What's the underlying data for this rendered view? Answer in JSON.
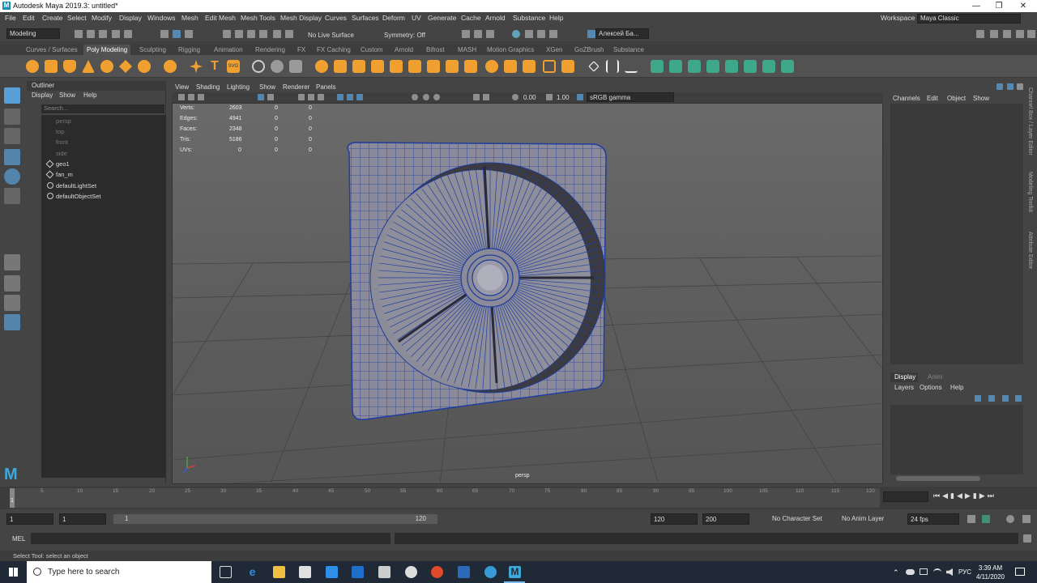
{
  "window": {
    "title": "Autodesk Maya 2019.3: untitled*",
    "logo": "M"
  },
  "menu": [
    "File",
    "Edit",
    "Create",
    "Select",
    "Modify",
    "Display",
    "Windows",
    "Mesh",
    "Edit Mesh",
    "Mesh Tools",
    "Mesh Display",
    "Curves",
    "Surfaces",
    "Deform",
    "UV",
    "Generate",
    "Cache",
    "Arnold",
    "Substance",
    "Help"
  ],
  "workspace": {
    "label": "Workspace :",
    "value": "Maya Classic"
  },
  "status": {
    "mode": "Modeling",
    "live_surface": "No Live Surface",
    "symmetry": "Symmetry: Off",
    "user": "Алексей Ба..."
  },
  "shelf_tabs": [
    "Curves / Surfaces",
    "Poly Modeling",
    "Sculpting",
    "Rigging",
    "Animation",
    "Rendering",
    "FX",
    "FX Caching",
    "Custom",
    "Arnold",
    "Bifrost",
    "MASH",
    "Motion Graphics",
    "XGen",
    "GoZBrush",
    "Substance"
  ],
  "shelf_active": "Poly Modeling",
  "outliner": {
    "title": "Outliner",
    "menu": [
      "Display",
      "Show",
      "Help"
    ],
    "search_placeholder": "Search...",
    "items": [
      "persp",
      "top",
      "front",
      "side",
      "geo1",
      "fan_m",
      "defaultLightSet",
      "defaultObjectSet"
    ]
  },
  "viewport": {
    "menu": [
      "View",
      "Shading",
      "Lighting",
      "Show",
      "Renderer",
      "Panels"
    ],
    "exposure": "0.00",
    "gamma": "1.00",
    "colorspace": "sRGB gamma",
    "camera": "persp",
    "hud": {
      "labels": [
        "Verts:",
        "Edges:",
        "Faces:",
        "Tris:",
        "UVs:"
      ],
      "col1": [
        "2603",
        "4941",
        "2348",
        "5186",
        "0"
      ],
      "col2": [
        "0",
        "0",
        "0",
        "0",
        "0"
      ],
      "col3": [
        "0",
        "0",
        "0",
        "0",
        "0"
      ]
    }
  },
  "channel_box": {
    "menu": [
      "Channels",
      "Edit",
      "Object",
      "Show"
    ]
  },
  "layer_editor": {
    "tabs": [
      "Display",
      "Anim"
    ],
    "menu": [
      "Layers",
      "Options",
      "Help"
    ]
  },
  "side_tabs": [
    "Channel Box / Layer Editor",
    "Modeling Toolkit",
    "Attribute Editor"
  ],
  "timeline": {
    "ticks": [
      "1",
      "5",
      "10",
      "15",
      "20",
      "25",
      "30",
      "35",
      "40",
      "45",
      "50",
      "55",
      "60",
      "65",
      "70",
      "75",
      "80",
      "85",
      "90",
      "95",
      "100",
      "105",
      "110",
      "115",
      "120"
    ],
    "current_frame": "1"
  },
  "range": {
    "start": "1",
    "start2": "1",
    "slider_start": "1",
    "slider_end": "120",
    "end": "120",
    "end2": "200",
    "character_set": "No Character Set",
    "anim_layer": "No Anim Layer",
    "fps": "24 fps"
  },
  "mel": {
    "label": "MEL"
  },
  "help_line": "Select Tool: select an object",
  "taskbar": {
    "search_placeholder": "Type here to search",
    "time": "3:39 AM",
    "date": "4/11/2020",
    "lang": "РУС"
  },
  "colors": {
    "accent": "#5aa0d8",
    "selection_blue": "#1f3d9e",
    "shelf_green": "#3fa88a",
    "shelf_orange": "#f0a030"
  }
}
